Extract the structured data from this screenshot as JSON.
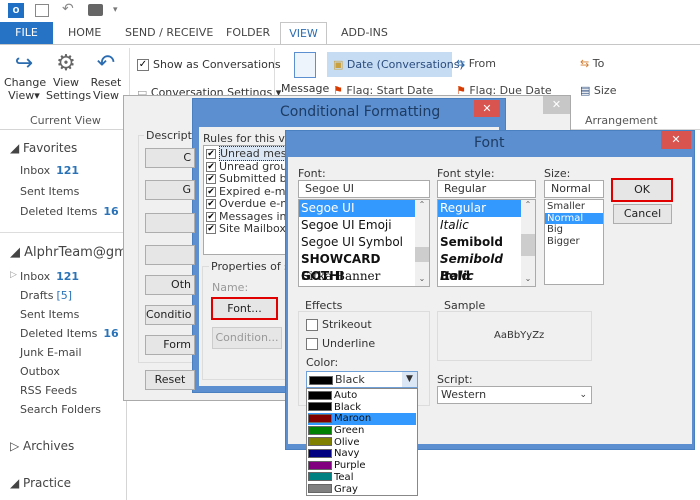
{
  "titlebar": {
    "icons": [
      "outlook-icon",
      "send-receive-icon",
      "undo-icon",
      "print-icon",
      "customize-icon"
    ]
  },
  "tabs": [
    "FILE",
    "HOME",
    "SEND / RECEIVE",
    "FOLDER",
    "VIEW",
    "ADD-INS"
  ],
  "ribbon": {
    "change_view": [
      "Change",
      "View"
    ],
    "view_settings": [
      "View",
      "Settings"
    ],
    "reset_view": [
      "Reset",
      "View"
    ],
    "current_view_label": "Current View",
    "show_conversations": "Show as Conversations",
    "conversation_settings": "Conversation Settings",
    "message": "Message",
    "arrange": [
      "Date (Conversations)",
      "From",
      "To",
      "Flag: Start Date",
      "Flag: Due Date",
      "Size"
    ],
    "arrangement_label": "Arrangement"
  },
  "sidebar": {
    "favorites": "Favorites",
    "fav_items": [
      {
        "label": "Inbox",
        "count": "121"
      },
      {
        "label": "Sent Items",
        "count": ""
      },
      {
        "label": "Deleted Items",
        "count": "16"
      }
    ],
    "account": "AlphrTeam@gmai",
    "acct_items": [
      {
        "label": "Inbox",
        "count": "121"
      },
      {
        "label": "Drafts",
        "count": "[5]"
      },
      {
        "label": "Sent Items",
        "count": ""
      },
      {
        "label": "Deleted Items",
        "count": "16"
      },
      {
        "label": "Junk E-mail",
        "count": ""
      },
      {
        "label": "Outbox",
        "count": ""
      },
      {
        "label": "RSS Feeds",
        "count": ""
      },
      {
        "label": "Search Folders",
        "count": ""
      }
    ],
    "archives": "Archives",
    "practice": "Practice"
  },
  "view_settings": {
    "description": "Descriptio",
    "buttons": [
      "C",
      "G",
      "",
      "",
      "Oth",
      "Conditio",
      "Form",
      "Reset"
    ]
  },
  "cond": {
    "title": "Conditional Formatting",
    "rules_label": "Rules for this view",
    "rules": [
      "Unread messa",
      "Unread group",
      "Submitted bu",
      "Expired e-mai",
      "Overdue e-ma",
      "Messages in",
      "Site Mailbox"
    ],
    "properties": "Properties of se",
    "name_label": "Name:",
    "font_btn": "Font...",
    "condition_btn": "Condition..."
  },
  "font": {
    "title": "Font",
    "font_label": "Font:",
    "font_value": "Segoe UI",
    "fonts": [
      "Segoe UI",
      "Segoe UI Emoji",
      "Segoe UI Symbol",
      "SHOWCARD GOTHI",
      "Sitka Banner"
    ],
    "style_label": "Font style:",
    "style_value": "Regular",
    "styles": [
      "Regular",
      "Italic",
      "Semibold",
      "Semibold Italic",
      "Bold"
    ],
    "size_label": "Size:",
    "size_value": "Normal",
    "sizes": [
      "Smaller",
      "Normal",
      "Big",
      "Bigger"
    ],
    "ok": "OK",
    "cancel": "Cancel",
    "effects": "Effects",
    "strikeout": "Strikeout",
    "underline": "Underline",
    "color_label": "Color:",
    "color_value": "Black",
    "colors": [
      {
        "name": "Auto",
        "hex": "#000000"
      },
      {
        "name": "Black",
        "hex": "#000000"
      },
      {
        "name": "Maroon",
        "hex": "#800000"
      },
      {
        "name": "Green",
        "hex": "#008000"
      },
      {
        "name": "Olive",
        "hex": "#808000"
      },
      {
        "name": "Navy",
        "hex": "#000080"
      },
      {
        "name": "Purple",
        "hex": "#800080"
      },
      {
        "name": "Teal",
        "hex": "#008080"
      },
      {
        "name": "Gray",
        "hex": "#808080"
      }
    ],
    "sample_label": "Sample",
    "sample_text": "AaBbYyZz",
    "script_label": "Script:",
    "script_value": "Western"
  }
}
